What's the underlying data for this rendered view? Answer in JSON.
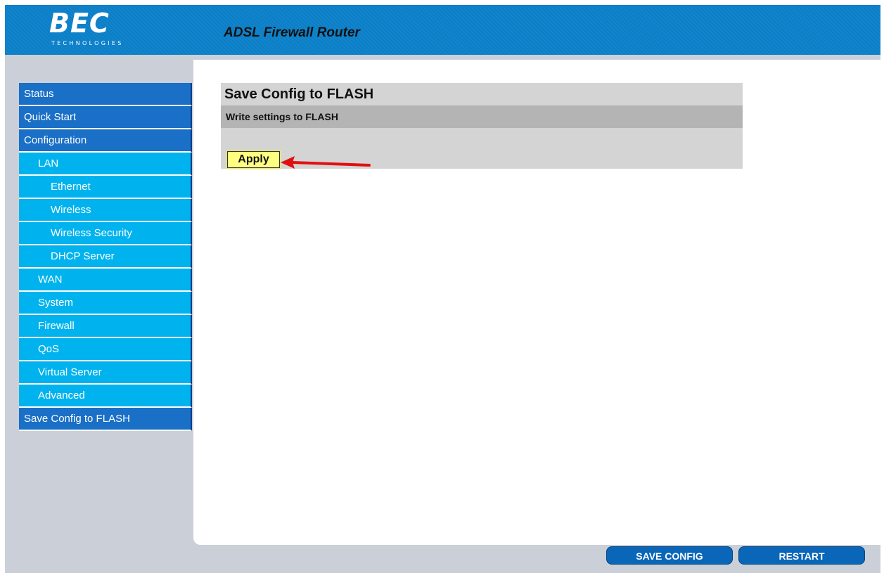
{
  "brand": {
    "logo": "BEC",
    "logo_subtitle": "TECHNOLOGIES",
    "product": "ADSL Firewall Router"
  },
  "sidebar": {
    "items": [
      {
        "label": "Status",
        "level": 1
      },
      {
        "label": "Quick Start",
        "level": 1
      },
      {
        "label": "Configuration",
        "level": 1
      },
      {
        "label": "LAN",
        "level": 2
      },
      {
        "label": "Ethernet",
        "level": 3
      },
      {
        "label": "Wireless",
        "level": 3
      },
      {
        "label": "Wireless Security",
        "level": 3
      },
      {
        "label": "DHCP Server",
        "level": 3
      },
      {
        "label": "WAN",
        "level": 2
      },
      {
        "label": "System",
        "level": 2
      },
      {
        "label": "Firewall",
        "level": 2
      },
      {
        "label": "QoS",
        "level": 2
      },
      {
        "label": "Virtual Server",
        "level": 2
      },
      {
        "label": "Advanced",
        "level": 2
      },
      {
        "label": "Save Config to FLASH",
        "level": 1
      }
    ]
  },
  "main": {
    "title": "Save Config to FLASH",
    "subtitle": "Write settings to FLASH",
    "apply_label": "Apply"
  },
  "footer": {
    "save_config_label": "SAVE CONFIG",
    "restart_label": "RESTART"
  },
  "colors": {
    "header": "#0a7fc8",
    "nav_primary": "#1a6fc6",
    "nav_secondary": "#00b3ee",
    "apply_button": "#ffff80",
    "arrow": "#e01010"
  }
}
